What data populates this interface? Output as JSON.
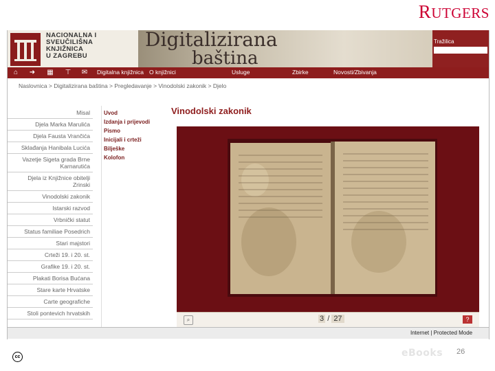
{
  "slide": {
    "brand_prefix": "R",
    "brand_rest": "UTGERS",
    "page_number": "26",
    "cc_label": "cc",
    "footer_logo": "eBooks"
  },
  "header": {
    "logo_lines": [
      "NACIONALNA I",
      "SVEUČILIŠNA",
      "KNJIŽNICA",
      "U ZAGREBU"
    ],
    "banner_title": "Digitalizirana",
    "banner_sub": "baština",
    "search_label": "Tražilica"
  },
  "nav": {
    "icons": [
      "home-icon",
      "arrow-icon",
      "sitemap-icon",
      "tree-icon",
      "mail-icon"
    ],
    "items": [
      "Digitalna knjižnica",
      "O knjižnici",
      "Usluge",
      "Zbirke",
      "Novosti/Zbivanja"
    ]
  },
  "breadcrumb": "Naslovnica > Digitalizirana baština > Pregledavanje > Vinodolski zakonik > Djelo",
  "menu": [
    "Misal",
    "Djela Marka Marulića",
    "Djela Fausta Vrančića",
    "Sklađanja Hanibala Lucića",
    "Vazetje Sigeta grada Brne Karnarutića",
    "Djela iz Knjižnice obitelji Zrinski",
    "Vinodolski zakonik",
    "Istarski razvod",
    "Vrbnički statut",
    "Status familiae Posedrich",
    "Stari majstori",
    "Crteži 19. i 20. st.",
    "Grafike 19. i 20. st.",
    "Plakati Borisa Bućana",
    "Stare karte Hrvatske",
    "Carte geografiche",
    "Stoli pontevich hrvatskih"
  ],
  "submenu": [
    "Uvod",
    "Izdanja i prijevodi",
    "Pismo",
    "Inicijali i crteži",
    "Bilješke",
    "Kolofon"
  ],
  "content": {
    "title": "Vinodolski zakonik"
  },
  "viewer": {
    "current_page": "3",
    "separator": "/",
    "total_pages": "27",
    "help_label": "?"
  },
  "status": {
    "zone": "Internet | Protected Mode"
  },
  "colors": {
    "accent": "#8e1d1d",
    "brand": "#cc0033"
  }
}
